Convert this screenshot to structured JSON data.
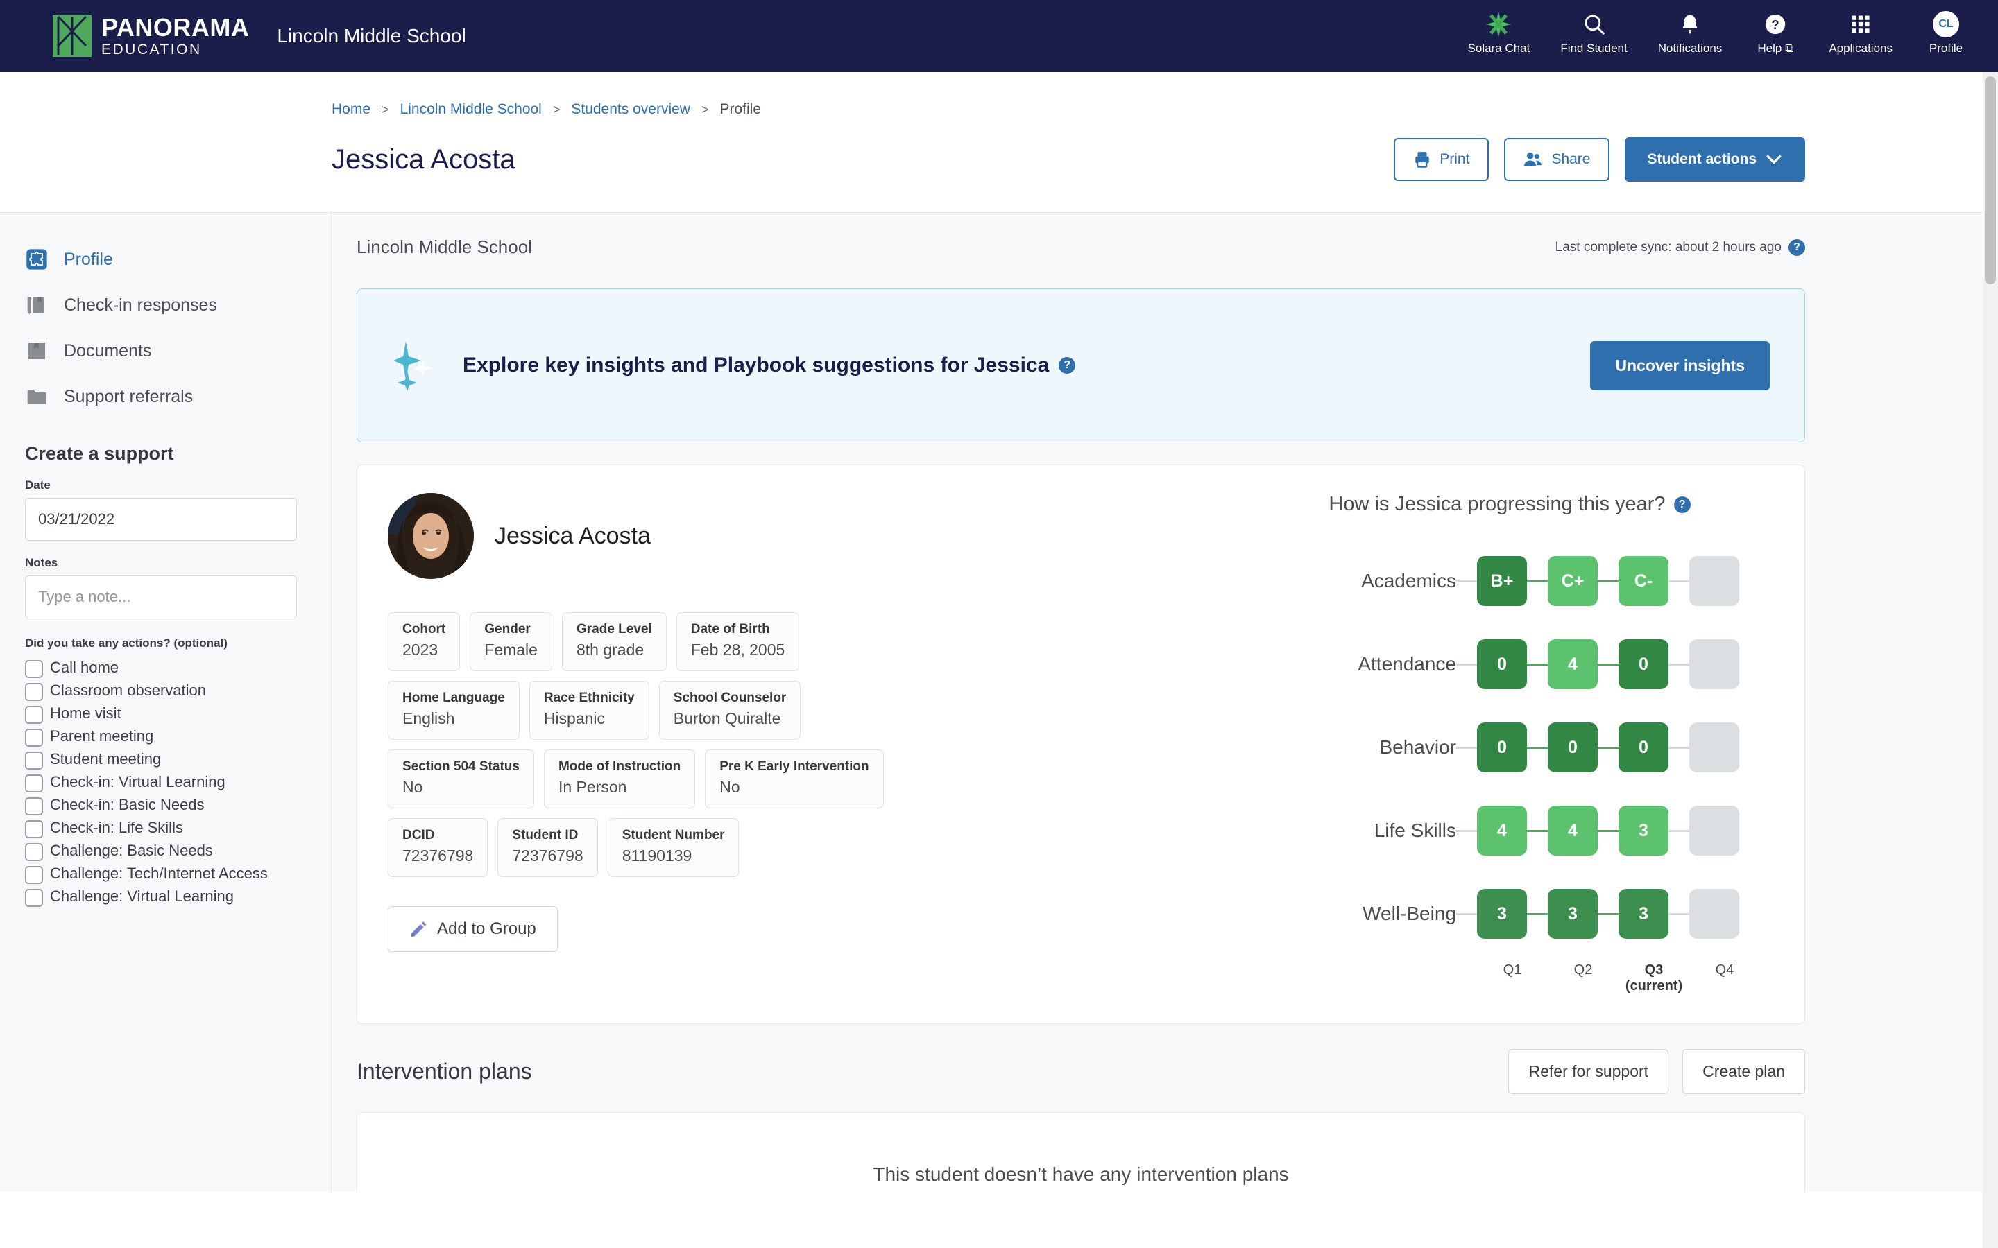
{
  "topnav": {
    "logo_line1": "PANORAMA",
    "logo_line2": "EDUCATION",
    "school": "Lincoln Middle School",
    "items": [
      {
        "label": "Solara Chat",
        "icon": "sparkle-star-icon"
      },
      {
        "label": "Find Student",
        "icon": "search-icon"
      },
      {
        "label": "Notifications",
        "icon": "bell-icon"
      },
      {
        "label": "Help ⧉",
        "icon": "help-circle-icon"
      },
      {
        "label": "Applications",
        "icon": "grid-apps-icon"
      },
      {
        "label": "Profile",
        "icon": "avatar-icon",
        "initials": "CL"
      }
    ]
  },
  "breadcrumb": {
    "items": [
      "Home",
      "Lincoln Middle School",
      "Students overview",
      "Profile"
    ],
    "separator": ">"
  },
  "header": {
    "title": "Jessica Acosta",
    "print_label": "Print",
    "share_label": "Share",
    "student_actions_label": "Student actions"
  },
  "sidebar": {
    "nav": [
      {
        "label": "Profile",
        "icon": "puzzle-icon",
        "active": true
      },
      {
        "label": "Check-in responses",
        "icon": "book-pencil-icon",
        "active": false
      },
      {
        "label": "Documents",
        "icon": "book-icon",
        "active": false
      },
      {
        "label": "Support referrals",
        "icon": "folder-icon",
        "active": false
      }
    ],
    "form": {
      "heading": "Create a support",
      "date_label": "Date",
      "date_value": "03/21/2022",
      "notes_label": "Notes",
      "notes_value": "",
      "notes_placeholder": "Type a note...",
      "actions_question": "Did you take any actions? (optional)",
      "checkboxes": [
        "Call home",
        "Classroom observation",
        "Home visit",
        "Parent meeting",
        "Student meeting",
        "Check-in: Virtual Learning",
        "Check-in: Basic Needs",
        "Check-in: Life Skills",
        "Challenge: Basic Needs",
        "Challenge: Tech/Internet Access",
        "Challenge: Virtual Learning"
      ]
    }
  },
  "main": {
    "school": "Lincoln Middle School",
    "sync_text": "Last complete sync: about 2 hours ago",
    "insights": {
      "text": "Explore key insights and Playbook suggestions for Jessica",
      "button": "Uncover insights"
    },
    "student": {
      "name": "Jessica Acosta",
      "add_to_group_label": "Add to Group",
      "fields": [
        [
          {
            "key": "Cohort",
            "value": "2023"
          },
          {
            "key": "Gender",
            "value": "Female"
          },
          {
            "key": "Grade Level",
            "value": "8th grade"
          },
          {
            "key": "Date of Birth",
            "value": "Feb 28, 2005"
          }
        ],
        [
          {
            "key": "Home Language",
            "value": "English"
          },
          {
            "key": "Race Ethnicity",
            "value": "Hispanic"
          },
          {
            "key": "School Counselor",
            "value": "Burton Quiralte"
          }
        ],
        [
          {
            "key": "Section 504 Status",
            "value": "No"
          },
          {
            "key": "Mode of Instruction",
            "value": "In Person"
          },
          {
            "key": "Pre K Early Intervention",
            "value": "No"
          }
        ],
        [
          {
            "key": "DCID",
            "value": "72376798"
          },
          {
            "key": "Student ID",
            "value": "72376798"
          },
          {
            "key": "Student Number",
            "value": "81190139"
          }
        ]
      ]
    },
    "intervention": {
      "title": "Intervention plans",
      "refer_label": "Refer for support",
      "create_label": "Create plan",
      "empty_text": "This student doesn’t have any intervention plans"
    }
  },
  "chart_data": {
    "type": "heatmap",
    "title": "How is Jessica progressing this year?",
    "categories": [
      "Q1",
      "Q2",
      "Q3",
      "Q4"
    ],
    "current_quarter": "Q3",
    "current_label": "(current)",
    "rows": [
      {
        "name": "Academics",
        "values": [
          "B+",
          "C+",
          "C-",
          ""
        ],
        "colors": [
          "#338744",
          "#5cc26e",
          "#5cc26e",
          "#dcdfe1"
        ]
      },
      {
        "name": "Attendance",
        "values": [
          "0",
          "4",
          "0",
          ""
        ],
        "colors": [
          "#338744",
          "#5cc26e",
          "#338744",
          "#dcdfe1"
        ]
      },
      {
        "name": "Behavior",
        "values": [
          "0",
          "0",
          "0",
          ""
        ],
        "colors": [
          "#338744",
          "#338744",
          "#338744",
          "#dcdfe1"
        ]
      },
      {
        "name": "Life Skills",
        "values": [
          "4",
          "4",
          "3",
          ""
        ],
        "colors": [
          "#5cc26e",
          "#5cc26e",
          "#5cc26e",
          "#dcdfe1"
        ]
      },
      {
        "name": "Well-Being",
        "values": [
          "3",
          "3",
          "3",
          ""
        ],
        "colors": [
          "#3d8f4f",
          "#3d8f4f",
          "#3d8f4f",
          "#dcdfe1"
        ]
      }
    ],
    "legend": [],
    "grid": false
  },
  "colors": {
    "brand_navy": "#1b1e4b",
    "accent_blue": "#2f6fad",
    "green_dark": "#338744",
    "green_light": "#5cc26e",
    "empty_gray": "#dcdfe1",
    "banner_bg": "#eef7fc"
  }
}
